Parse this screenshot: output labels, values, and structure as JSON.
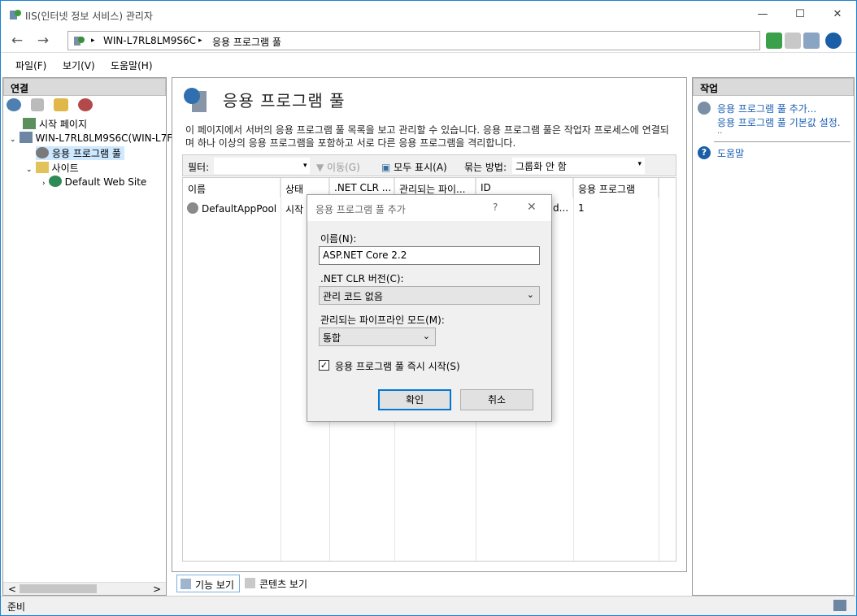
{
  "window": {
    "title": "IIS(인터넷 정보 서비스) 관리자",
    "minimize": "—",
    "maximize": "☐",
    "close": "✕"
  },
  "address": {
    "back": "←",
    "forward": "→",
    "separator": "▸",
    "crumbs": [
      "WIN-L7RL8LM9S6C",
      "응용 프로그램 풀"
    ]
  },
  "menu": [
    "파일(F)",
    "보기(V)",
    "도움말(H)"
  ],
  "left_panel": {
    "title": "연결",
    "tree": [
      "시작 페이지",
      "WIN-L7RL8LM9S6C(WIN-L7F",
      "응용 프로그램 풀",
      "사이트",
      "Default Web Site"
    ],
    "scroll_left": "<",
    "scroll_right": ">"
  },
  "center": {
    "title": "응용 프로그램 풀",
    "description": "이 페이지에서 서버의 응용 프로그램 풀 목록을 보고 관리할 수 있습니다. 응용 프로그램 풀은 작업자 프로세스에 연결되며 하나 이상의 응용 프로그램을 포함하고 서로 다른 응용 프로그램을 격리합니다.",
    "filter": {
      "label": "필터:",
      "go": "이동(G)",
      "show_all": "모두 표시(A)",
      "group_label": "묶는 방법:",
      "group_value": "그룹화 안 함"
    },
    "columns": [
      "이름",
      "상태",
      ".NET CLR ...",
      "관리되는 파이...",
      "ID",
      "응용 프로그램"
    ],
    "rows": [
      {
        "name": "DefaultAppPool",
        "status": "시작",
        "id_tail": "d...",
        "apps": "1"
      }
    ],
    "tabs": [
      "기능 보기",
      "콘텐츠 보기"
    ]
  },
  "right_panel": {
    "title": "작업",
    "actions": [
      "응용 프로그램 풀 추가...",
      "응용 프로그램 풀 기본값 설정.",
      ".."
    ],
    "help": "도움말"
  },
  "status": {
    "text": "준비"
  },
  "dialog": {
    "title": "응용 프로그램 풀 추가",
    "help": "?",
    "close": "✕",
    "name_label": "이름(N):",
    "name_value": "ASP.NET Core 2.2",
    "clr_label": ".NET CLR 버전(C):",
    "clr_value": "관리 코드 없음",
    "pipeline_label": "관리되는 파이프라인 모드(M):",
    "pipeline_value": "통합",
    "start_label": "응용 프로그램 풀 즉시 시작(S)",
    "start_checked": "✓",
    "ok": "확인",
    "cancel": "취소"
  }
}
